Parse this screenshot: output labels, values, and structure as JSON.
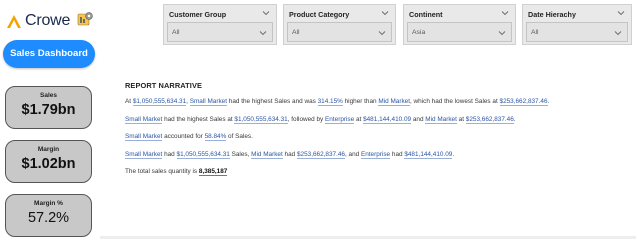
{
  "brand": {
    "name": "Crowe",
    "accent_color": "#f5a300"
  },
  "nav": {
    "dashboard_label": "Sales Dashboard"
  },
  "kpis": {
    "sales": {
      "label": "Sales",
      "value": "$1.79bn"
    },
    "margin": {
      "label": "Margin",
      "value": "$1.02bn"
    },
    "margin_pct": {
      "label": "Margin %",
      "value": "57.2%"
    }
  },
  "filters": {
    "customer_group": {
      "title": "Customer Group",
      "value": "All"
    },
    "product_category": {
      "title": "Product Category",
      "value": "All"
    },
    "continent": {
      "title": "Continent",
      "value": "Asia"
    },
    "date_hierarchy": {
      "title": "Date Hierachy",
      "value": "All"
    }
  },
  "narrative": {
    "title": "REPORT NARRATIVE",
    "p1": {
      "t1": "At ",
      "v1": "$1,050,555,634.31",
      "t2": ", ",
      "v2": "Small Market",
      "t3": " had the highest Sales and was ",
      "v3": "314.15%",
      "t4": " higher than ",
      "v4": "Mid Market",
      "t5": ", which had the lowest Sales at ",
      "v5": "$253,662,837.46",
      "t6": "."
    },
    "p2": {
      "v1": "Small Market",
      "t1": " had the highest Sales at ",
      "v2": "$1,050,555,634.31",
      "t2": ", followed by ",
      "v3": "Enterprise",
      "t3": " at ",
      "v4": "$481,144,410.09",
      "t4": " and ",
      "v5": "Mid Market",
      "t5": " at ",
      "v6": "$253,662,837.46",
      "t6": "."
    },
    "p3": {
      "v1": "Small Market",
      "t1": " accounted for ",
      "v2": "58.84%",
      "t2": " of Sales."
    },
    "p4": {
      "v1": "Small Market",
      "t1": " had ",
      "v2": "$1,050,555,634.31",
      "t2": " Sales, ",
      "v3": "Mid Market",
      "t3": " had ",
      "v4": "$253,662,837.46",
      "t4": ", and ",
      "v5": "Enterprise",
      "t5": " had ",
      "v6": "$481,144,410.09",
      "t6": "."
    },
    "p5": {
      "t1": "The total sales quantity is ",
      "v1": "8,385,187"
    }
  }
}
